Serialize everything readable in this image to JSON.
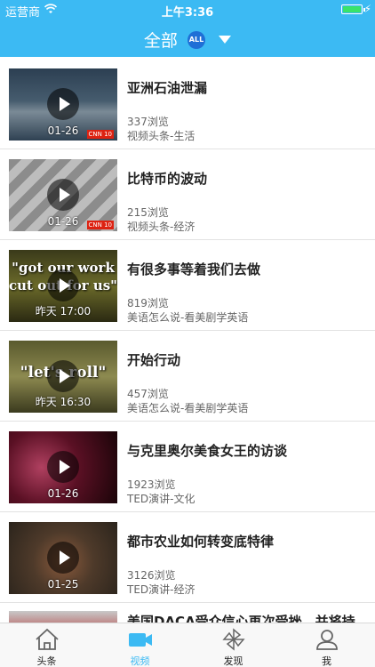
{
  "status_bar": {
    "carrier": "运营商",
    "time": "上午3:36",
    "battery_level": 1.0
  },
  "nav": {
    "title": "全部",
    "badge": "ALL"
  },
  "videos": [
    {
      "stamp": "01-26",
      "title": "亚洲石油泄漏",
      "views": "337浏览",
      "source": "视频头条-生活",
      "logo": "CNN 10"
    },
    {
      "stamp": "01-26",
      "title": "比特币的波动",
      "views": "215浏览",
      "source": "视频头条-经济",
      "logo": "CNN 10"
    },
    {
      "stamp": "昨天 17:00",
      "title": "有很多事等着我们去做",
      "views": "819浏览",
      "source": "美语怎么说-看美剧学英语",
      "caption": "\"got our work cut out for us\""
    },
    {
      "stamp": "昨天 16:30",
      "title": "开始行动",
      "views": "457浏览",
      "source": "美语怎么说-看美剧学英语",
      "caption": "\"let's roll\""
    },
    {
      "stamp": "01-26",
      "title": "与克里奥尔美食女王的访谈",
      "views": "1923浏览",
      "source": "TED演讲-文化"
    },
    {
      "stamp": "01-25",
      "title": "都市农业如何转变底特律",
      "views": "3126浏览",
      "source": "TED演讲-经济"
    },
    {
      "title": "美国DACA受众信心再次受挫，并将持"
    }
  ],
  "tabs": [
    {
      "label": "头条",
      "icon": "home-icon"
    },
    {
      "label": "视频",
      "icon": "video-camera-icon"
    },
    {
      "label": "发现",
      "icon": "pinwheel-icon"
    },
    {
      "label": "我",
      "icon": "user-icon"
    }
  ],
  "colors": {
    "accent": "#3cbaf3",
    "badge": "#1f6fd6"
  }
}
